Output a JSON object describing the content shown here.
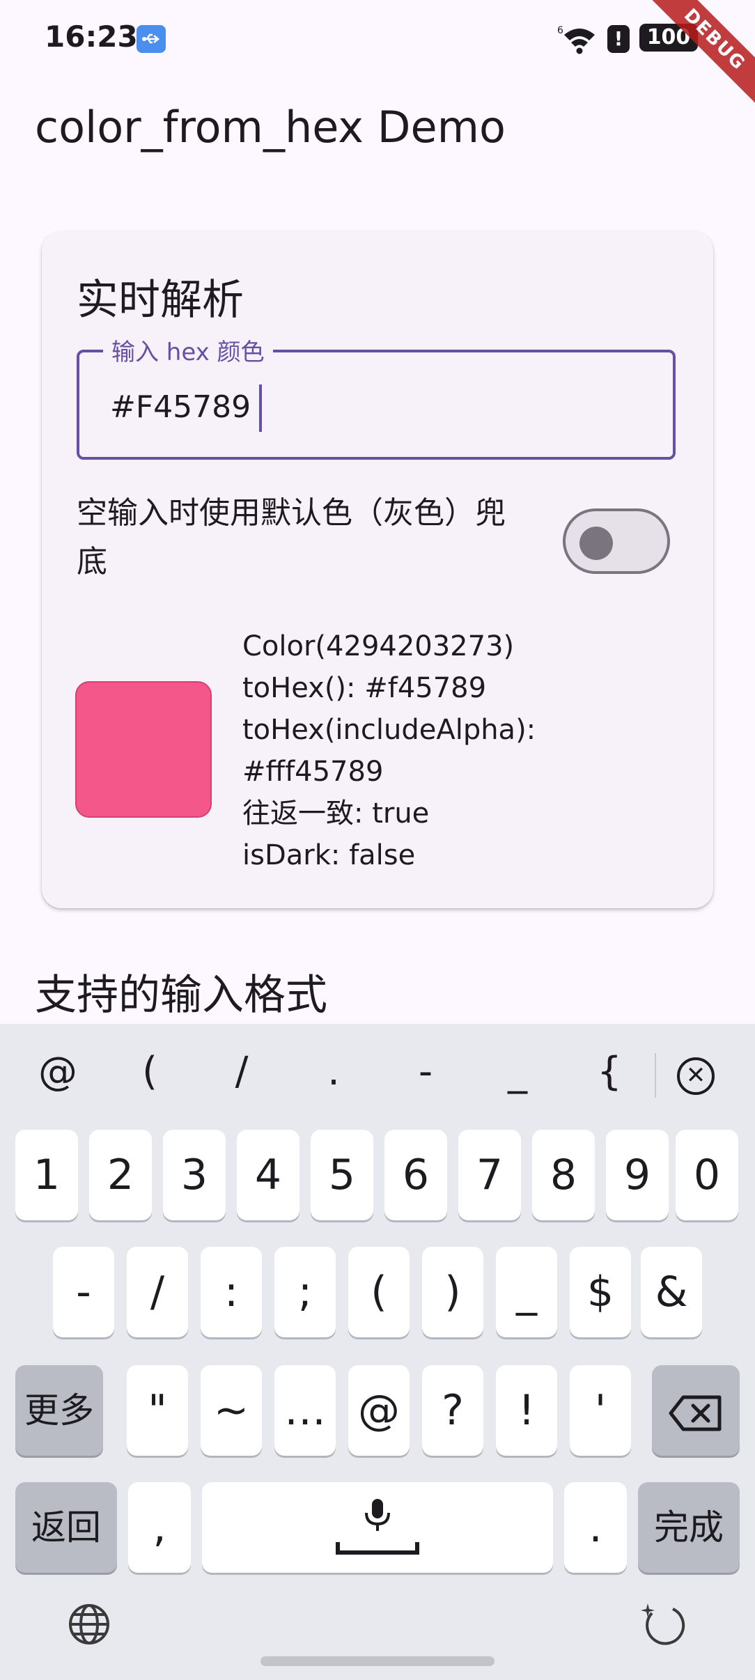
{
  "status_bar": {
    "time": "16:23",
    "signal_label": "6",
    "battery": "100",
    "debug_banner": "DEBUG",
    "icons": [
      "usb-icon",
      "wifi-icon",
      "alert-icon",
      "battery-icon",
      "charging-icon"
    ]
  },
  "app_bar": {
    "title": "color_from_hex Demo"
  },
  "card": {
    "title": "实时解析",
    "input": {
      "label": "输入 hex 颜色",
      "value": "#F45789"
    },
    "toggle": {
      "label": "空输入时使用默认色（灰色）兜底",
      "on": false
    },
    "preview": {
      "color": "#f45789",
      "lines": [
        "Color(4294203273)",
        "toHex(): #f45789",
        "toHex(includeAlpha):",
        "#fff45789",
        "往返一致: true",
        "isDark: false"
      ]
    }
  },
  "section": {
    "title": "支持的输入格式"
  },
  "keyboard": {
    "symbols": [
      "@",
      "(",
      "/",
      ".",
      "-",
      "_",
      "{"
    ],
    "numbers": [
      "1",
      "2",
      "3",
      "4",
      "5",
      "6",
      "7",
      "8",
      "9",
      "0"
    ],
    "row2": [
      "-",
      "/",
      ":",
      ";",
      "(",
      ")",
      "_",
      "$",
      "&"
    ],
    "row3_more": "更多",
    "row3": [
      "\"",
      "~",
      "…",
      "@",
      "?",
      "!",
      "'"
    ],
    "back": "返回",
    "comma": ",",
    "period": ".",
    "done": "完成",
    "icons": [
      "clear-icon",
      "backspace-icon",
      "mic-icon",
      "globe-icon",
      "rotate-icon"
    ]
  },
  "colors": {
    "primary": "#6750a4",
    "background": "#fdf7ff",
    "card": "#f7f2fa",
    "swatch": "#f45789"
  }
}
